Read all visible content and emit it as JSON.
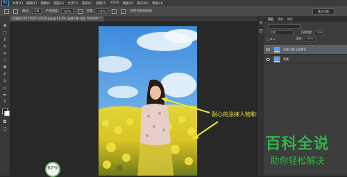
{
  "menubar": {
    "logo": "Ps",
    "items": [
      "文件(F)",
      "编辑(E)",
      "图像(I)",
      "图层(L)",
      "文字(Y)",
      "选择(S)",
      "滤镜(T)",
      "3D(D)",
      "视图(V)",
      "窗口(W)",
      "帮助(H)"
    ]
  },
  "options": {
    "mode_label": "模式:",
    "mode_value": "正常",
    "opacity_label": "不透明度:",
    "opacity_value": "100%",
    "flow_label": "流量:",
    "flow_value": "100%",
    "sample_label": "对所有图层取样",
    "workspace": "基本功能"
  },
  "document": {
    "tab_label": "QQ图片20170527123709.jpg @ 61.4% (去掉人物 与花, RGB/8#) *"
  },
  "layers_panel": {
    "tabs": [
      "图层",
      "通道",
      "路径"
    ],
    "blend_mode": "正常",
    "opacity_label": "不透明度:",
    "opacity_value": "52%",
    "fill_label": "填充:",
    "fill_value": "100%",
    "layers": [
      {
        "name": "去掉人物 与花拷贝",
        "selected": true
      },
      {
        "name": "背景",
        "selected": false
      }
    ]
  },
  "annotation": "耐心的涂抹人物和花",
  "watermark": {
    "title": "百科全说",
    "subtitle": "助你轻松解决"
  },
  "zoom": "62%",
  "colors": {
    "annotation": "#f1e43a",
    "watermark": "#2fb34a",
    "accent": "#31a8ff"
  }
}
